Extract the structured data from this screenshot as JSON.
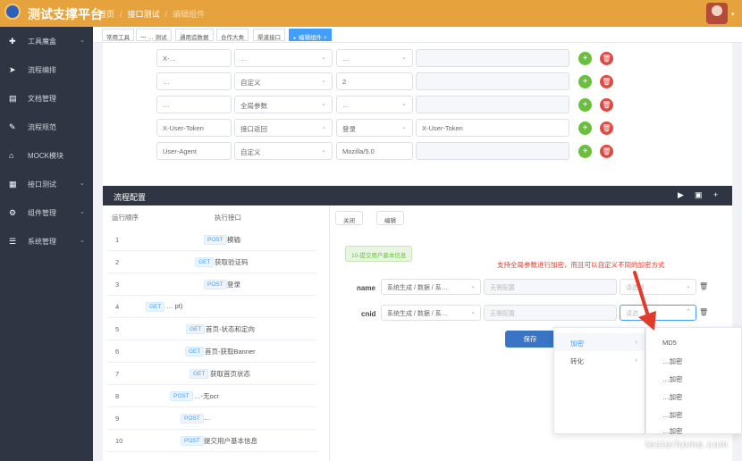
{
  "header": {
    "title": "测试支撑平台",
    "breadcrumb": [
      "首页",
      "接口测试",
      "编辑组件"
    ]
  },
  "sidebar": {
    "items": [
      {
        "icon": "tools-icon",
        "label": "工具魔盒",
        "arrow": true
      },
      {
        "icon": "send-icon",
        "label": "流程编排",
        "arrow": false
      },
      {
        "icon": "document-icon",
        "label": "文档管理",
        "arrow": false
      },
      {
        "icon": "flow-icon",
        "label": "流程规范",
        "arrow": false
      },
      {
        "icon": "mock-icon",
        "label": "MOCK模块",
        "arrow": false
      },
      {
        "icon": "grid-icon",
        "label": "接口测试",
        "arrow": true
      },
      {
        "icon": "component-icon",
        "label": "组件管理",
        "arrow": true
      },
      {
        "icon": "list-icon",
        "label": "系统管理",
        "arrow": true
      }
    ]
  },
  "tabs": [
    {
      "label": "常用工具",
      "active": false
    },
    {
      "label": "一 … 测试",
      "active": false
    },
    {
      "label": "通用造数据",
      "active": false
    },
    {
      "label": "合作大类",
      "active": false
    },
    {
      "label": "渠道接口",
      "active": false
    },
    {
      "label": "编辑组件",
      "active": true,
      "close": "×"
    }
  ],
  "params": {
    "rows": [
      {
        "name": "X-…",
        "source": "…",
        "value": "…",
        "extra": ""
      },
      {
        "name": "…",
        "source": "自定义",
        "value": "2",
        "extra": ""
      },
      {
        "name": "…",
        "source": "全局参数",
        "value": "…",
        "extra": ""
      },
      {
        "name": "X-User-Token",
        "source": "接口返回",
        "value": "登录",
        "extra": "X-User-Token"
      },
      {
        "name": "User-Agent",
        "source": "自定义",
        "value": "Mozilla/5.0",
        "extra": ""
      }
    ]
  },
  "flow_panel": {
    "title": "流程配置",
    "col_order": "运行顺序",
    "col_api": "执行接口",
    "steps": [
      {
        "n": "1",
        "method": "POST",
        "name": "模输"
      },
      {
        "n": "2",
        "method": "GET",
        "name": "获取验证码"
      },
      {
        "n": "3",
        "method": "POST",
        "name": "登录"
      },
      {
        "n": "4",
        "method": "GET",
        "name": "… pt)"
      },
      {
        "n": "5",
        "method": "GET",
        "name": "首页-状态和定向"
      },
      {
        "n": "6",
        "method": "GET",
        "name": "首页-获取Banner"
      },
      {
        "n": "7",
        "method": "GET",
        "name": "获取首页状态"
      },
      {
        "n": "8",
        "method": "POST",
        "name": "…-无ocr"
      },
      {
        "n": "9",
        "method": "POST",
        "name": "…"
      },
      {
        "n": "10",
        "method": "POST",
        "name": "提交用户基本信息"
      }
    ],
    "btn_close": "关闭",
    "btn_edit": "编辑",
    "tag": "10-提交用户基本信息",
    "note": "支持全局参数进行加密，而且可以自定义不同的加密方式",
    "fields": [
      {
        "label": "name",
        "source": "系统生成 / 数据 / 系…",
        "config": "无需配置",
        "select": "请选择"
      },
      {
        "label": "cnid",
        "source": "系统生成 / 数据 / 系…",
        "config": "无需配置",
        "select": "请选"
      }
    ],
    "save": "保存"
  },
  "cascader": {
    "level1": [
      {
        "label": "加密",
        "active": true
      },
      {
        "label": "转化",
        "active": false
      }
    ],
    "level2": [
      "MD5",
      "…加密",
      "…加密",
      "…加密",
      "…加密",
      "…加密"
    ]
  },
  "watermark": "testerhome.com",
  "colors": {
    "topbar": "#e6a23c",
    "sidebar": "#2f3542",
    "accent": "#409eff",
    "add": "#67c23a",
    "del": "#e04a45",
    "note": "#e03b2b"
  }
}
